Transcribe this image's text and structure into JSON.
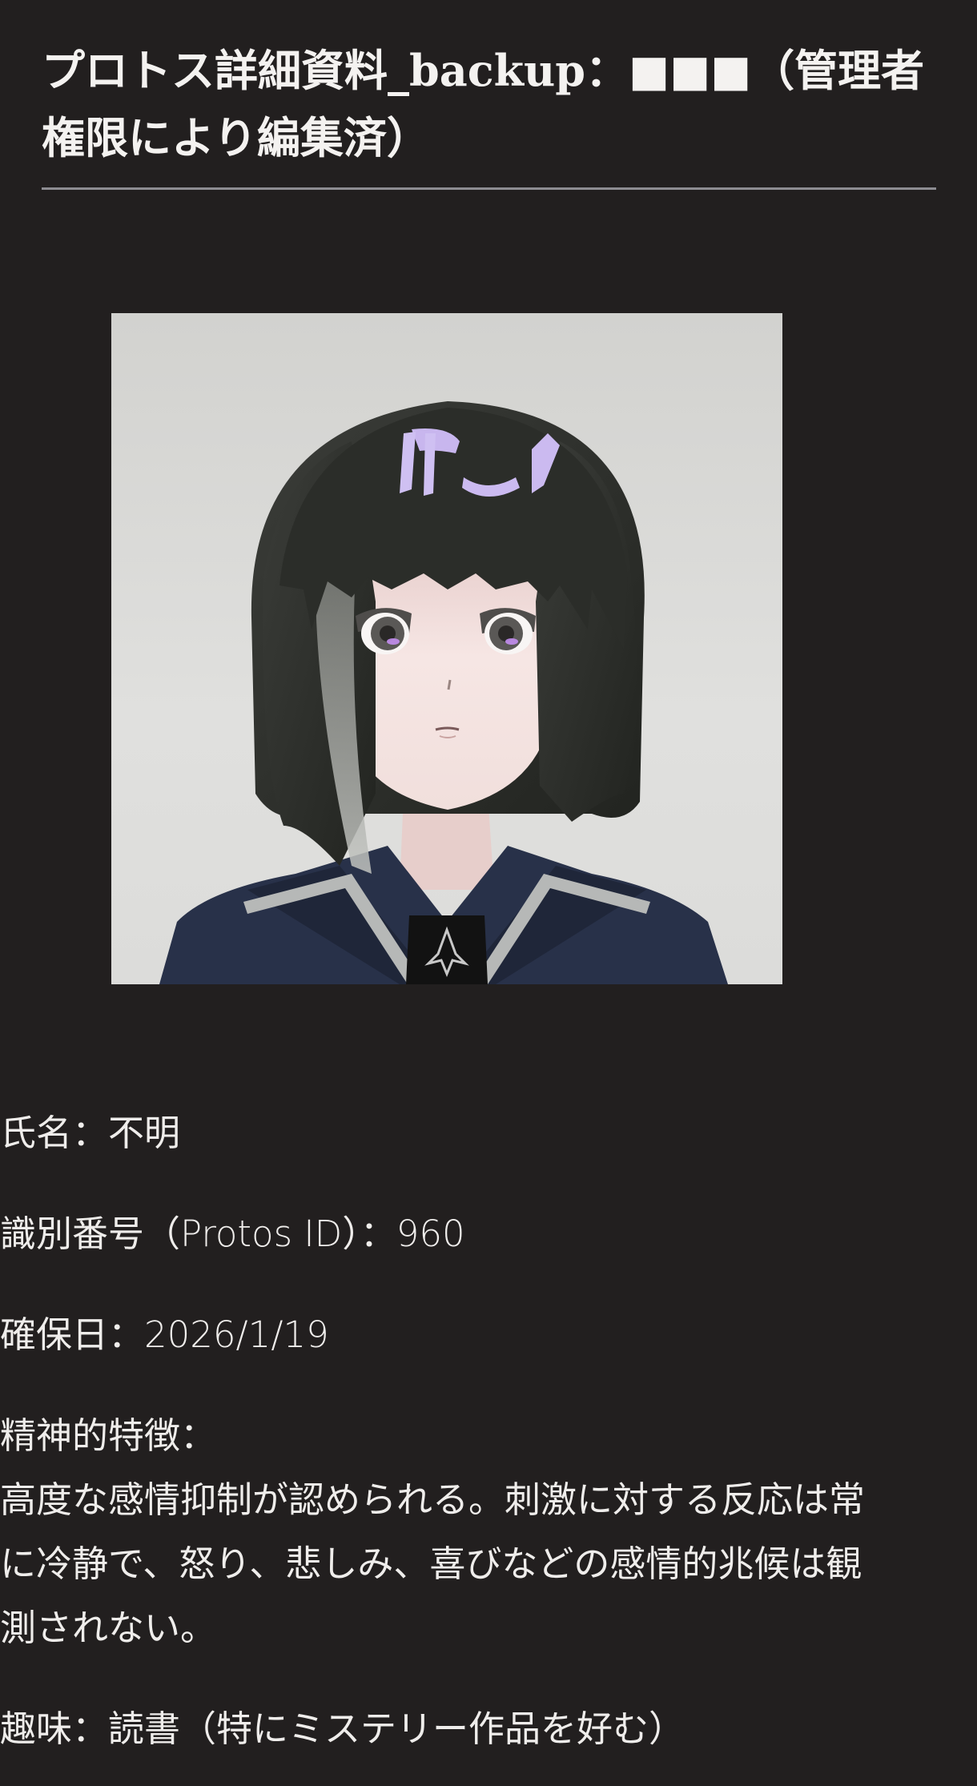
{
  "document": {
    "title": "プロトス詳細資料_backup：■■■（管理者権限により編集済）",
    "portrait": {
      "alt_icon": "portrait-illustration",
      "colors": {
        "background": "#d8d8d5",
        "hair": "#2d2f2b",
        "skin": "#f1dcda",
        "uniform": "#2a3348",
        "highlight": "#c9b7ef"
      }
    },
    "fields": {
      "name": "氏名：不明",
      "id": "識別番号（Protos ID）：960",
      "date": "確保日：2026/1/19",
      "mental_label": "精神的特徴：",
      "mental_text": "高度な感情抑制が認められる。刺激に対する反応は常に冷静で、怒り、悲しみ、喜びなどの感情的兆候は観測されない。",
      "hobby": "趣味：読書（特にミステリー作品を好む）"
    }
  }
}
